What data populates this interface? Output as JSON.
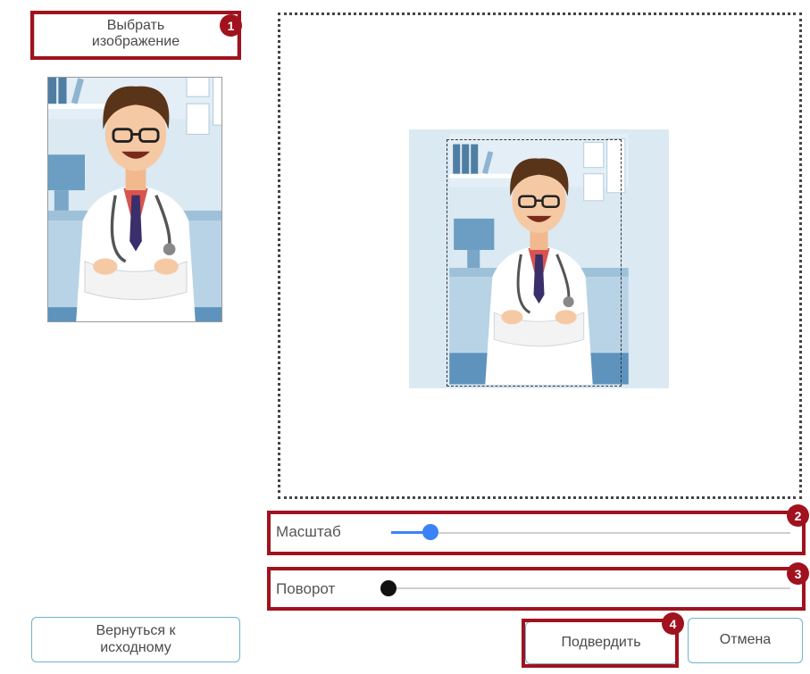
{
  "select_image": {
    "label": "Выбрать изображение"
  },
  "sliders": {
    "scale": {
      "label": "Масштаб",
      "level": 0.08
    },
    "rotate": {
      "label": "Поворот",
      "level": 0.0
    }
  },
  "buttons": {
    "reset": "Вернуться к исходному",
    "confirm": "Подвердить",
    "cancel": "Отмена"
  },
  "annotations": [
    "1",
    "2",
    "3",
    "4"
  ],
  "colors": {
    "annotation": "#a0121e",
    "accent": "#3b82f6",
    "button_border": "#6fb3d0"
  }
}
